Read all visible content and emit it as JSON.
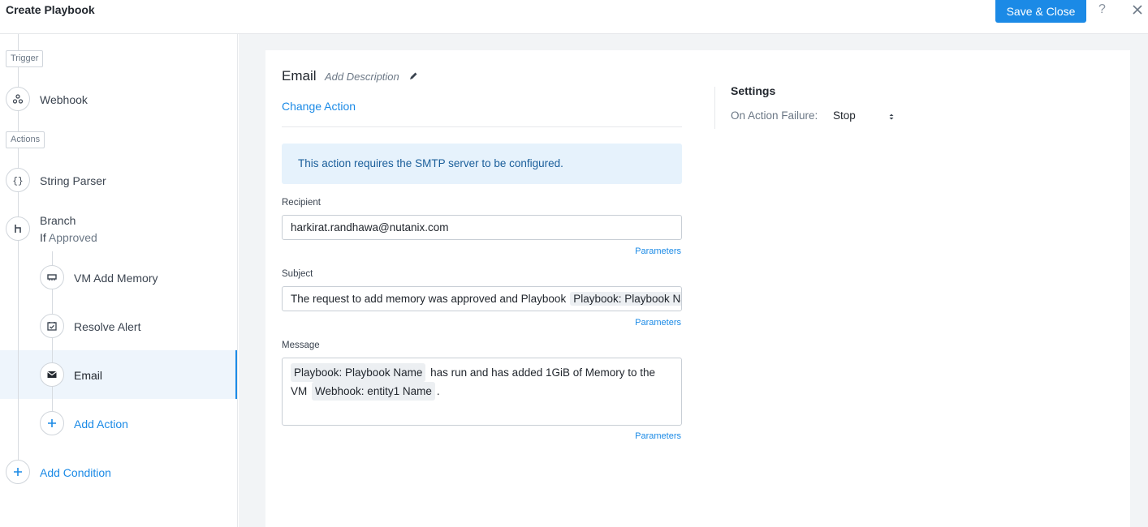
{
  "header": {
    "title": "Create Playbook",
    "save_label": "Save & Close",
    "help": "?"
  },
  "sidebar": {
    "trigger_tag": "Trigger",
    "trigger": "Webhook",
    "actions_tag": "Actions",
    "string_parser": "String Parser",
    "branch": "Branch",
    "branch_if": "If",
    "branch_condition": "Approved",
    "vm_add_memory": "VM Add Memory",
    "resolve_alert": "Resolve Alert",
    "email": "Email",
    "add_action": "Add Action",
    "add_condition": "Add Condition"
  },
  "main": {
    "action_title": "Email",
    "add_description": "Add Description",
    "change_action": "Change Action",
    "info": "This action requires the SMTP server to be configured.",
    "recipient_label": "Recipient",
    "recipient_value": "harkirat.randhawa@nutanix.com",
    "subject_label": "Subject",
    "subject_text": "The request to add memory was approved and Playbook",
    "subject_chip": "Playbook: Playbook Name",
    "message_label": "Message",
    "message_chip1": "Playbook: Playbook Name",
    "message_text1": "has run and has added 1GiB of Memory to the",
    "message_text2": "VM",
    "message_chip2": "Webhook: entity1 Name",
    "message_text3": ".",
    "parameters": "Parameters"
  },
  "settings": {
    "title": "Settings",
    "failure_label": "On Action Failure:",
    "failure_value": "Stop"
  },
  "colors": {
    "accent": "#1b8ae6",
    "info_bg": "#e6f2fc",
    "active_row": "#eef5fc"
  }
}
